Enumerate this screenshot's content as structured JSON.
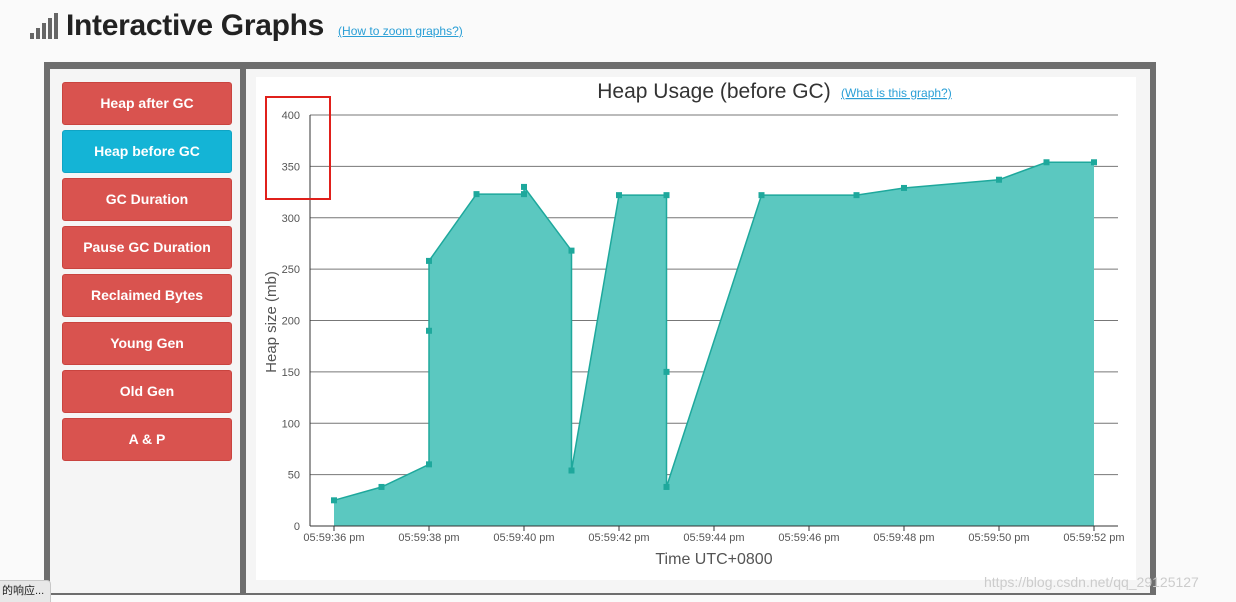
{
  "header": {
    "title": "Interactive Graphs",
    "help_link": "(How to zoom graphs?)"
  },
  "sidebar": {
    "items": [
      {
        "label": "Heap after GC",
        "active": false
      },
      {
        "label": "Heap before GC",
        "active": true
      },
      {
        "label": "GC Duration",
        "active": false
      },
      {
        "label": "Pause GC Duration",
        "active": false
      },
      {
        "label": "Reclaimed Bytes",
        "active": false
      },
      {
        "label": "Young Gen",
        "active": false
      },
      {
        "label": "Old Gen",
        "active": false
      },
      {
        "label": "A & P",
        "active": false
      }
    ]
  },
  "colors": {
    "active_button": "#14b4d6",
    "button": "#d9534f",
    "area_fill": "#5bc8c0",
    "area_line": "#1ea89c",
    "highlight_box": "#e0201b"
  },
  "chart_data": {
    "type": "area",
    "title": "Heap Usage (before GC)",
    "help_link": "(What is this graph?)",
    "xlabel": "Time UTC+0800",
    "ylabel": "Heap size (mb)",
    "ylim": [
      0,
      400
    ],
    "yticks": [
      "0",
      "50",
      "100",
      "150",
      "200",
      "250",
      "300",
      "350",
      "400"
    ],
    "xlim": [
      "05:59:36 pm",
      "05:59:52 pm"
    ],
    "xticks": [
      "05:59:36 pm",
      "05:59:38 pm",
      "05:59:40 pm",
      "05:59:42 pm",
      "05:59:44 pm",
      "05:59:46 pm",
      "05:59:48 pm",
      "05:59:50 pm",
      "05:59:52 pm"
    ],
    "grid": true,
    "points": [
      {
        "x": "05:59:36 pm",
        "y": 25
      },
      {
        "x": "05:59:37 pm",
        "y": 38
      },
      {
        "x": "05:59:38 pm",
        "y": 60
      },
      {
        "x": "05:59:38 pm",
        "y": 190
      },
      {
        "x": "05:59:38 pm",
        "y": 258
      },
      {
        "x": "05:59:39 pm",
        "y": 323
      },
      {
        "x": "05:59:40 pm",
        "y": 323
      },
      {
        "x": "05:59:40 pm",
        "y": 330
      },
      {
        "x": "05:59:41 pm",
        "y": 268
      },
      {
        "x": "05:59:41 pm",
        "y": 54
      },
      {
        "x": "05:59:42 pm",
        "y": 322
      },
      {
        "x": "05:59:43 pm",
        "y": 322
      },
      {
        "x": "05:59:43 pm",
        "y": 150
      },
      {
        "x": "05:59:43 pm",
        "y": 38
      },
      {
        "x": "05:59:45 pm",
        "y": 322
      },
      {
        "x": "05:59:47 pm",
        "y": 322
      },
      {
        "x": "05:59:48 pm",
        "y": 329
      },
      {
        "x": "05:59:50 pm",
        "y": 337
      },
      {
        "x": "05:59:51 pm",
        "y": 354
      },
      {
        "x": "05:59:52 pm",
        "y": 354
      }
    ]
  },
  "status_tooltip": "的响应...",
  "watermark": "https://blog.csdn.net/qq_29125127"
}
